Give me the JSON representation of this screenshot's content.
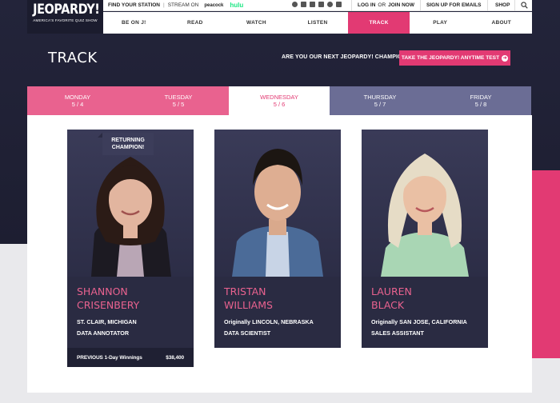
{
  "header": {
    "logo": "JEOPARDY!",
    "tagline": "AMERICA'S FAVORITE QUIZ SHOW",
    "find_station": "FIND YOUR STATION",
    "stream_on": "STREAM ON",
    "peacock": "peacock",
    "hulu": "hulu",
    "login": "LOG IN",
    "or": "OR",
    "join": "JOIN NOW",
    "signup": "SIGN UP FOR EMAILS",
    "shop": "SHOP"
  },
  "nav": {
    "items": [
      "BE ON J!",
      "READ",
      "WATCH",
      "LISTEN",
      "TRACK",
      "PLAY",
      "ABOUT"
    ],
    "active": "TRACK"
  },
  "page": {
    "title": "TRACK",
    "promo_question": "ARE YOU OUR NEXT JEOPARDY! CHAMPION?",
    "promo_button": "TAKE THE JEOPARDY! ANYTIME TEST"
  },
  "days": [
    {
      "name": "MONDAY",
      "date": "5 / 4"
    },
    {
      "name": "TUESDAY",
      "date": "5 / 5"
    },
    {
      "name": "WEDNESDAY",
      "date": "5 / 6"
    },
    {
      "name": "THURSDAY",
      "date": "5 / 7"
    },
    {
      "name": "FRIDAY",
      "date": "5 / 8"
    }
  ],
  "badge": {
    "line1": "RETURNING",
    "line2": "CHAMPION!"
  },
  "contestants": [
    {
      "first": "SHANNON",
      "last": "CRISENBERY",
      "origin": "ST. CLAIR, MICHIGAN",
      "job": "DATA ANNOTATOR",
      "winnings_label": "PREVIOUS 1-Day Winnings",
      "winnings_value": "$38,400"
    },
    {
      "first": "TRISTAN",
      "last": "WILLIAMS",
      "origin": "Originally LINCOLN, NEBRASKA",
      "job": "DATA SCIENTIST"
    },
    {
      "first": "LAUREN",
      "last": "BLACK",
      "origin": "Originally SAN JOSE, CALIFORNIA",
      "job": "SALES ASSISTANT"
    }
  ],
  "colors": {
    "accent": "#e23a73",
    "dark": "#23243a",
    "slate": "#6b6d95"
  }
}
